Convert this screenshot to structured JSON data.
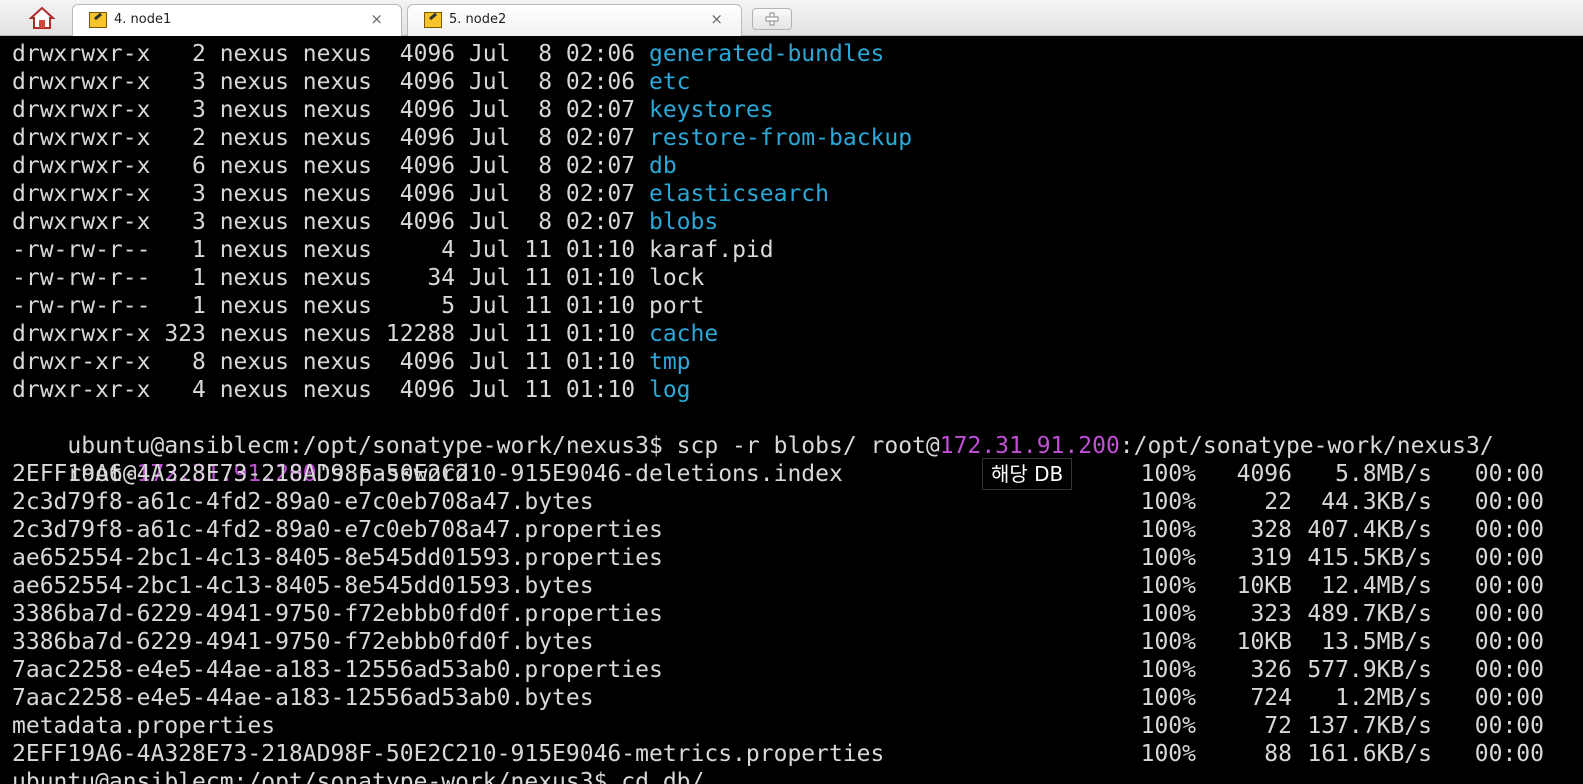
{
  "tabs": [
    {
      "label": "4. node1",
      "close": "×",
      "active": true
    },
    {
      "label": "5. node2",
      "close": "×",
      "active": false
    }
  ],
  "home_icon": "home-icon",
  "new_tab_icon": "plus-icon",
  "listing": [
    {
      "perms": "drwxrwxr-x",
      "links": "2",
      "user": "nexus",
      "group": "nexus",
      "size": "4096",
      "date": "Jul  8 02:06",
      "name": "generated-bundles",
      "is_dir": true
    },
    {
      "perms": "drwxrwxr-x",
      "links": "3",
      "user": "nexus",
      "group": "nexus",
      "size": "4096",
      "date": "Jul  8 02:06",
      "name": "etc",
      "is_dir": true
    },
    {
      "perms": "drwxrwxr-x",
      "links": "3",
      "user": "nexus",
      "group": "nexus",
      "size": "4096",
      "date": "Jul  8 02:07",
      "name": "keystores",
      "is_dir": true
    },
    {
      "perms": "drwxrwxr-x",
      "links": "2",
      "user": "nexus",
      "group": "nexus",
      "size": "4096",
      "date": "Jul  8 02:07",
      "name": "restore-from-backup",
      "is_dir": true
    },
    {
      "perms": "drwxrwxr-x",
      "links": "6",
      "user": "nexus",
      "group": "nexus",
      "size": "4096",
      "date": "Jul  8 02:07",
      "name": "db",
      "is_dir": true
    },
    {
      "perms": "drwxrwxr-x",
      "links": "3",
      "user": "nexus",
      "group": "nexus",
      "size": "4096",
      "date": "Jul  8 02:07",
      "name": "elasticsearch",
      "is_dir": true
    },
    {
      "perms": "drwxrwxr-x",
      "links": "3",
      "user": "nexus",
      "group": "nexus",
      "size": "4096",
      "date": "Jul  8 02:07",
      "name": "blobs",
      "is_dir": true
    },
    {
      "perms": "-rw-rw-r--",
      "links": "1",
      "user": "nexus",
      "group": "nexus",
      "size": "4",
      "date": "Jul 11 01:10",
      "name": "karaf.pid",
      "is_dir": false
    },
    {
      "perms": "-rw-rw-r--",
      "links": "1",
      "user": "nexus",
      "group": "nexus",
      "size": "34",
      "date": "Jul 11 01:10",
      "name": "lock",
      "is_dir": false
    },
    {
      "perms": "-rw-rw-r--",
      "links": "1",
      "user": "nexus",
      "group": "nexus",
      "size": "5",
      "date": "Jul 11 01:10",
      "name": "port",
      "is_dir": false
    },
    {
      "perms": "drwxrwxr-x",
      "links": "323",
      "user": "nexus",
      "group": "nexus",
      "size": "12288",
      "date": "Jul 11 01:10",
      "name": "cache",
      "is_dir": true
    },
    {
      "perms": "drwxr-xr-x",
      "links": "8",
      "user": "nexus",
      "group": "nexus",
      "size": "4096",
      "date": "Jul 11 01:10",
      "name": "tmp",
      "is_dir": true
    },
    {
      "perms": "drwxr-xr-x",
      "links": "4",
      "user": "nexus",
      "group": "nexus",
      "size": "4096",
      "date": "Jul 11 01:10",
      "name": "log",
      "is_dir": true
    }
  ],
  "scp_command": {
    "prompt": "ubuntu@ansiblecm:/opt/sonatype-work/nexus3$ ",
    "cmd_before_ip": "scp -r blobs/ root@",
    "ip": "172.31.91.200",
    "cmd_after_ip": ":/opt/sonatype-work/nexus3/"
  },
  "password_prompt": {
    "before_ip": "root@",
    "ip": "172.31.91.200",
    "after_ip": "'s password:"
  },
  "transfers": [
    {
      "file": "2EFF19A6-4A328E73-218AD98F-50E2C210-915E9046-deletions.index",
      "percent": "100%",
      "size": "4096",
      "rate": "5.8MB/s",
      "time": "00:00"
    },
    {
      "file": "2c3d79f8-a61c-4fd2-89a0-e7c0eb708a47.bytes",
      "percent": "100%",
      "size": "22",
      "rate": "44.3KB/s",
      "time": "00:00"
    },
    {
      "file": "2c3d79f8-a61c-4fd2-89a0-e7c0eb708a47.properties",
      "percent": "100%",
      "size": "328",
      "rate": "407.4KB/s",
      "time": "00:00"
    },
    {
      "file": "ae652554-2bc1-4c13-8405-8e545dd01593.properties",
      "percent": "100%",
      "size": "319",
      "rate": "415.5KB/s",
      "time": "00:00"
    },
    {
      "file": "ae652554-2bc1-4c13-8405-8e545dd01593.bytes",
      "percent": "100%",
      "size": "10KB",
      "rate": "12.4MB/s",
      "time": "00:00"
    },
    {
      "file": "3386ba7d-6229-4941-9750-f72ebbb0fd0f.properties",
      "percent": "100%",
      "size": "323",
      "rate": "489.7KB/s",
      "time": "00:00"
    },
    {
      "file": "3386ba7d-6229-4941-9750-f72ebbb0fd0f.bytes",
      "percent": "100%",
      "size": "10KB",
      "rate": "13.5MB/s",
      "time": "00:00"
    },
    {
      "file": "7aac2258-e4e5-44ae-a183-12556ad53ab0.properties",
      "percent": "100%",
      "size": "326",
      "rate": "577.9KB/s",
      "time": "00:00"
    },
    {
      "file": "7aac2258-e4e5-44ae-a183-12556ad53ab0.bytes",
      "percent": "100%",
      "size": "724",
      "rate": "1.2MB/s",
      "time": "00:00"
    },
    {
      "file": "metadata.properties",
      "percent": "100%",
      "size": "72",
      "rate": "137.7KB/s",
      "time": "00:00"
    },
    {
      "file": "2EFF19A6-4A328E73-218AD98F-50E2C210-915E9046-metrics.properties",
      "percent": "100%",
      "size": "88",
      "rate": "161.6KB/s",
      "time": "00:00"
    }
  ],
  "last_line": "ubuntu@ansiblecm:/opt/sonatype-work/nexus3$ cd db/",
  "caption": "해당 DB",
  "colors": {
    "directory": "#2aa8d8",
    "ip_highlight": "#c14fd6",
    "terminal_text": "#d8d8d8",
    "terminal_bg": "#000000"
  }
}
